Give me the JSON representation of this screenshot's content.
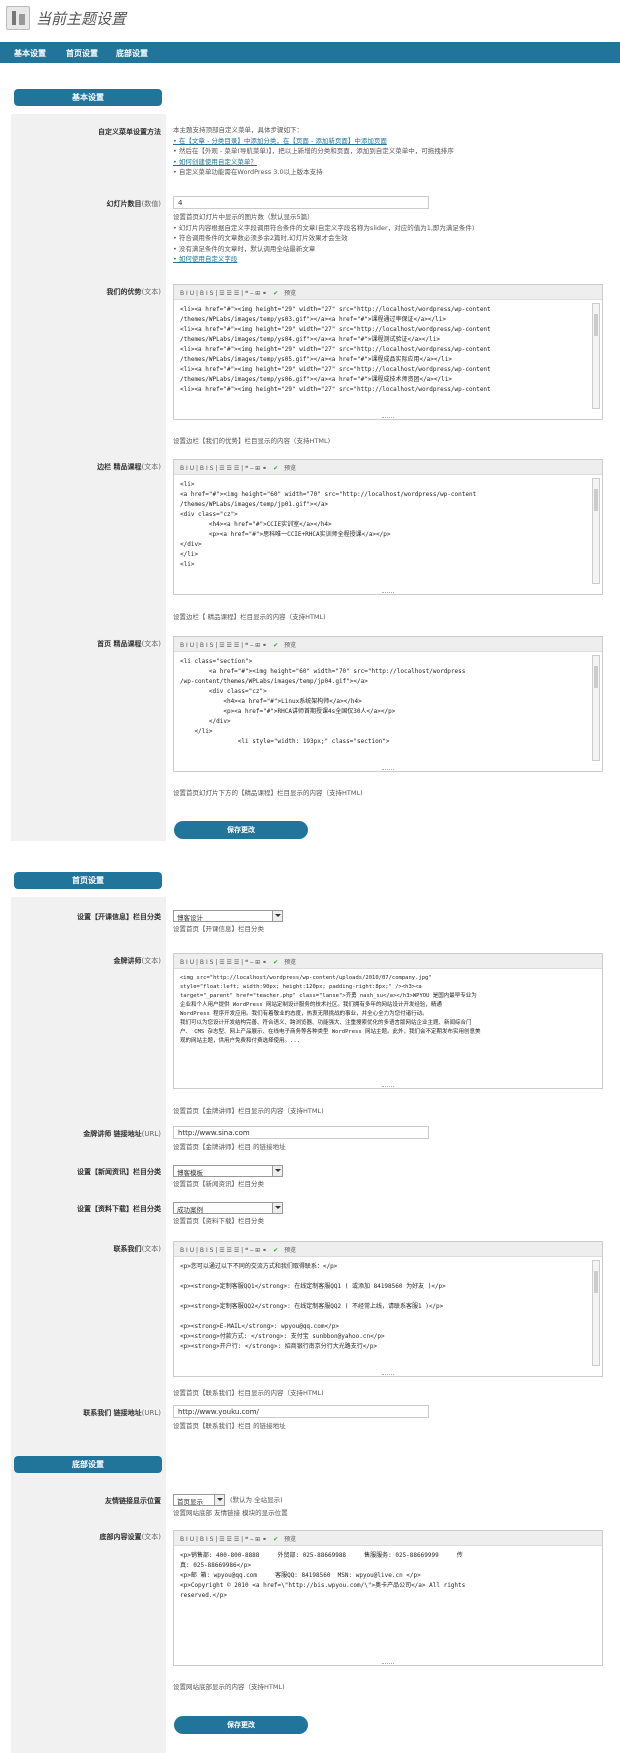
{
  "page_title": "当前主题设置",
  "topnav": [
    "基本设置",
    "首页设置",
    "底部设置"
  ],
  "sections": {
    "basic": "基本设置",
    "home": "首页设置",
    "footer": "底部设置"
  },
  "basic": {
    "menu_label": "自定义菜单设置方法",
    "menu_hints": [
      "本主题支持顶部自定义菜单，具体步骤如下：",
      "• 在【文章 - 分类目录】中添加分类，在【页面 - 添加新页面】中添加页面",
      "• 然后在【外观 - 菜单(导航菜单)】，把以上新增的分类和页面，添加到自定义菜单中，可拖拽排序",
      "• 如何创建使用自定义菜单？",
      "• 自定义菜单功能需在WordPress 3.0以上版本支持"
    ],
    "slides_label": "幻灯片数目",
    "slides_label_suffix": "(数值)",
    "slides_value": "4",
    "slides_hints": [
      "设置首页幻灯片中显示的图片数（默认显示5篇）",
      "• 幻灯片内容根据自定义字段调用符合条件的文章(自定义字段名称为slider，对应的值为1,即为满足条件)",
      "• 符合调用条件的文章数必须多余2篇时,幻灯片效果才会生效",
      "• 没有满足条件的文章时，默认调用全站最新文章",
      "• 如何使用自定义字段"
    ],
    "advantage_label": "我们的优势",
    "advantage_suffix": "(文本)",
    "advantage_code": "<li><a href=\"#\"><img height=\"29\" width=\"27\" src=\"http://localhost/wordpress/wp-content\n/themes/WPLabs/images/temp/ys03.gif\"></a><a href=\"#\">课程通过率保证</a></li>\n<li><a href=\"#\"><img height=\"29\" width=\"27\" src=\"http://localhost/wordpress/wp-content\n/themes/WPLabs/images/temp/ys04.gif\"></a><a href=\"#\">课程测试验证</a></li>\n<li><a href=\"#\"><img height=\"29\" width=\"27\" src=\"http://localhost/wordpress/wp-content\n/themes/WPLabs/images/temp/ys05.gif\"></a><a href=\"#\">课程成品实际应用</a></li>\n<li><a href=\"#\"><img height=\"29\" width=\"27\" src=\"http://localhost/wordpress/wp-content\n/themes/WPLabs/images/temp/ys06.gif\"></a><a href=\"#\">课程成技术师资团</a></li>\n<li><a href=\"#\"><img height=\"29\" width=\"27\" src=\"http://localhost/wordpress/wp-content",
    "advantage_hint": "设置边栏【我们的优势】栏目显示的内容（支持HTML)",
    "side_label": "边栏 精品课程",
    "side_suffix": "(文本)",
    "side_code": "<li>\n<a href=\"#\"><img height=\"60\" width=\"70\" src=\"http://localhost/wordpress/wp-content\n/themes/WPLabs/images/temp/jp01.gif\"></a>\n<div class=\"cz\">\n        <h4><a href=\"#\">CCIE实训室</a></h4>\n        <p><a href=\"#\">思科唯一CCIE+RHCA实训师全程授课</a></p>\n</div>\n</li>\n<li>",
    "side_hint": "设置边栏【 精品课程】栏目显示的内容（支持HTML)",
    "home_label": "首页 精品课程",
    "home_suffix": "(文本)",
    "home_code": "<li class=\"section\">\n        <a href=\"#\"><img height=\"60\" width=\"70\" src=\"http://localhost/wordpress\n/wp-content/themes/WPLabs/images/temp/jp04.gif\"></a>\n        <div class=\"cz\">\n            <h4><a href=\"#\">Linux系统架构师</a></h4>\n            <p><a href=\"#\">RHCA讲师首期授课4s全国仅30人</a></p>\n        </div>\n    </li>\n                <li style=\"width: 193px;\" class=\"section\">",
    "home_hint": "设置首页幻灯片下方的【精品课程】栏目显示的内容（支持HTML)",
    "save": "保存更改"
  },
  "home": {
    "cat1_label": "设置【开课信息】栏目分类",
    "cat1_value": "博客设计",
    "cat1_hint": "设置首页【开课信息】栏目分类",
    "teacher_label": "金牌讲师",
    "teacher_suffix": "(文本)",
    "teacher_code": "<img src=\"http://localhost/wordpress/wp-content/uploads/2010/07/company.jpg\"\nstyle=\"float:left; width:90px; height:120px; padding-right:8px;\" /><h3><a\ntarget=\"_parent\" href=\"teacher.php\" class=\"lanse\">齐勇 nash_su</a></h3>WPYOU 是国内最早专业为\n企业和个人用户提供 WordPress 网站定制设计服务的技术社区。我们拥有多年的网站设计开发经验，精通\nWordPress 程序开发应用。我们有着敬业的态度，热衷无限挑战的事业，并全心全力为您付诸行动。\n我们可以为您设计开发结构完善、符合语义、跨浏览器、功能强大、注重搜索优化的多语言版网站企业主题、新闻综合门\n户、 CMS 杂志型、网上产品展示、在线电子商务等各种类型 WordPress 网站主题。此外，我们会不定期发布实用创意美\n观的网站主题，供用户免费和付费选择使用。...",
    "teacher_hint": "设置首页【金牌讲师】栏目显示的内容（支持HTML)",
    "link_label": "金牌讲师 链接地址",
    "link_suffix": "(URL)",
    "link_value": "http://www.sina.com",
    "link_hint": "设置首页【金牌讲师】栏目 的链接地址",
    "cat2_label": "设置【新闻资讯】栏目分类",
    "cat2_value": "博客模板",
    "cat2_hint": "设置首页【新闻资讯】栏目分类",
    "cat3_label": "设置【资料下载】栏目分类",
    "cat3_value": "成功案例",
    "cat3_hint": "设置首页【资料下载】栏目分类",
    "contact_label": "联系我们",
    "contact_suffix": "(文本)",
    "contact_code": "<p>您可以通过以下不同的交流方式和我们取得联系：</p>\n\n<p><strong>定制客服QQ1</strong>: 在线定制客服QQ1 ( 或添加 84198560 为好友 )</p>\n\n<p><strong>定制客服QQ2</strong>: 在线定制客服QQ2 ( 不经常上线，请联系客服1 )</p>\n\n<p><strong>E-MAIL</strong>: wpyou@qq.com</p>\n<p><strong>付款方式: </strong>: 支付宝 sunbbon@yahoo.cn</p>\n<p><strong>开户行: </strong>: 招商银行南京分行大光路支行</p>",
    "contact_hint": "设置首页【联系我们】栏目显示的内容（支持HTML)",
    "clink_label": "联系我们 链接地址",
    "clink_suffix": "(URL)",
    "clink_value": "http://www.youku.com/",
    "clink_hint": "设置首页【联系我们】栏目 的链接地址"
  },
  "footer": {
    "pos_label": "友情链接显示位置",
    "pos_value": "首页显示",
    "pos_after": "(默认为 全站显示)",
    "pos_hint": "设置网站底部 友情链接 模块的显示位置",
    "content_label": "底部内容设置",
    "content_suffix": "(文本)",
    "content_code": "<p>销售部: 400-800-8888     外贸部: 025-88669988     售服服务: 025-88669999     传\n真: 025-88669986</p>\n<p>邮 箱: wpyou@qq.com     客服QQ: 84198560  MSN: wpyou@live.cn </p>\n<p>Copyright © 2010 <a href=\\\"http://bis.wpyou.com/\\\">奥卡产品公司</a> All rights\nreserved.</p>",
    "content_hint": "设置网站底部显示的内容（支持HTML)",
    "save": "保存更改"
  },
  "toolbar": "B  I  U  |  B  I  S  |  ☰  ☰  ☰  |  ❝  ⎯  ⊞  ⚭",
  "toolbar_check": "预览"
}
